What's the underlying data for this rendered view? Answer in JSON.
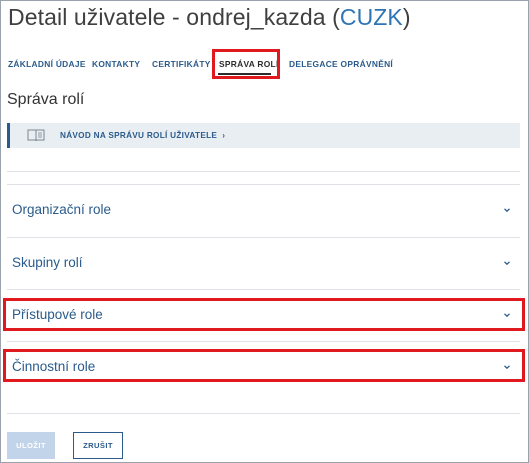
{
  "header": {
    "title_prefix": "Detail uživatele - ondrej_kazda (",
    "title_org": "CUZK",
    "title_suffix": ")"
  },
  "tabs": [
    {
      "label": "ZÁKLADNÍ ÚDAJE"
    },
    {
      "label": "KONTAKTY"
    },
    {
      "label": "CERTIFIKÁTY"
    },
    {
      "label": "SPRÁVA ROLÍ",
      "active": true
    },
    {
      "label": "DELEGACE OPRÁVNĚNÍ"
    }
  ],
  "section": {
    "title": "Správa rolí",
    "guide_link": "NÁVOD NA SPRÁVU ROLÍ UŽIVATELE",
    "guide_arrow": "›"
  },
  "accordions": [
    {
      "label": "Organizační role"
    },
    {
      "label": "Skupiny rolí"
    },
    {
      "label": "Přístupové role"
    },
    {
      "label": "Činnostní role"
    }
  ],
  "buttons": {
    "save": "ULOŽIT",
    "cancel": "ZRUŠIT"
  },
  "colors": {
    "accent": "#2a5b8c",
    "title_accent": "#2f75b5",
    "highlight": "#e0191f",
    "guide_background": "#e9eef3",
    "disabled_button": "#c2d4ea"
  },
  "icons": {
    "guide": "book-icon",
    "accordion": "chevron-down-icon"
  }
}
